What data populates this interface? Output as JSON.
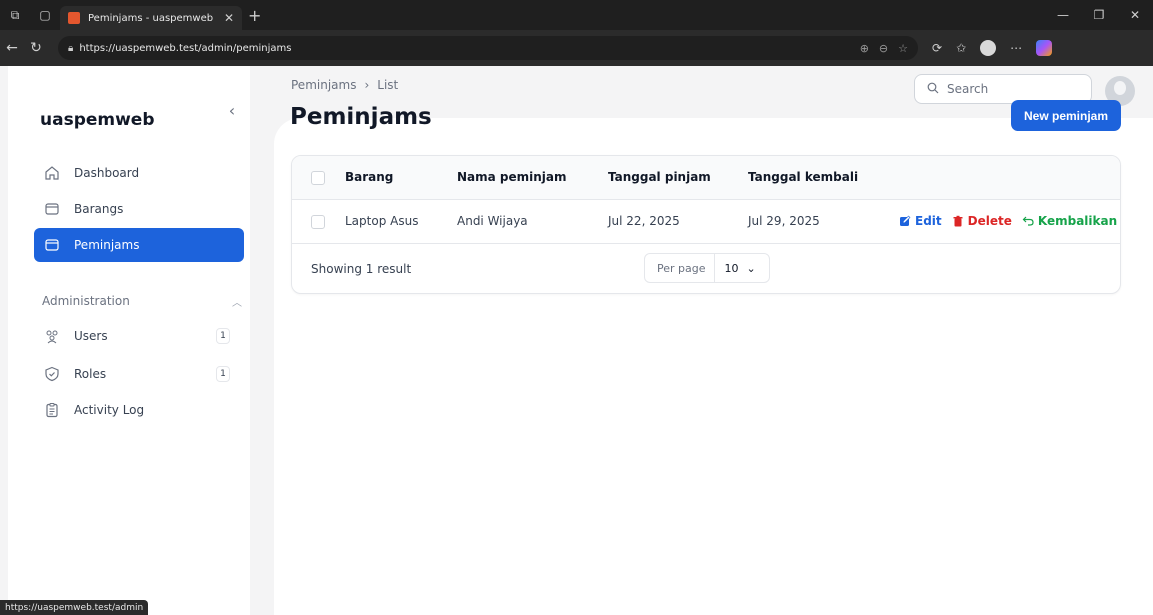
{
  "browser": {
    "tab_title": "Peminjams - uaspemweb",
    "url": "https://uaspemweb.test/admin/peminjams",
    "status_url": "https://uaspemweb.test/admin"
  },
  "sidebar": {
    "brand": "uaspemweb",
    "items": [
      {
        "label": "Dashboard",
        "icon": "home-icon"
      },
      {
        "label": "Barangs",
        "icon": "box-icon"
      },
      {
        "label": "Peminjams",
        "icon": "box-icon",
        "active": true
      }
    ],
    "group": {
      "label": "Administration",
      "items": [
        {
          "label": "Users",
          "badge": "1",
          "icon": "users-icon"
        },
        {
          "label": "Roles",
          "badge": "1",
          "icon": "shield-icon"
        },
        {
          "label": "Activity Log",
          "icon": "clipboard-icon"
        }
      ]
    }
  },
  "topbar": {
    "search_placeholder": "Search"
  },
  "page": {
    "breadcrumb": [
      "Peminjams",
      "List"
    ],
    "title": "Peminjams",
    "new_button": "New peminjam"
  },
  "table": {
    "columns": [
      "Barang",
      "Nama peminjam",
      "Tanggal pinjam",
      "Tanggal kembali"
    ],
    "rows": [
      {
        "barang": "Laptop Asus",
        "nama_peminjam": "Andi Wijaya",
        "tanggal_pinjam": "Jul 22, 2025",
        "tanggal_kembali": "Jul 29, 2025"
      }
    ],
    "actions": {
      "edit": "Edit",
      "delete": "Delete",
      "return": "Kembalikan"
    },
    "footer": {
      "summary": "Showing 1 result",
      "per_page_label": "Per page",
      "per_page_value": "10"
    }
  },
  "colors": {
    "primary": "#1d63dc",
    "danger": "#dc2626",
    "success": "#16a34a"
  }
}
